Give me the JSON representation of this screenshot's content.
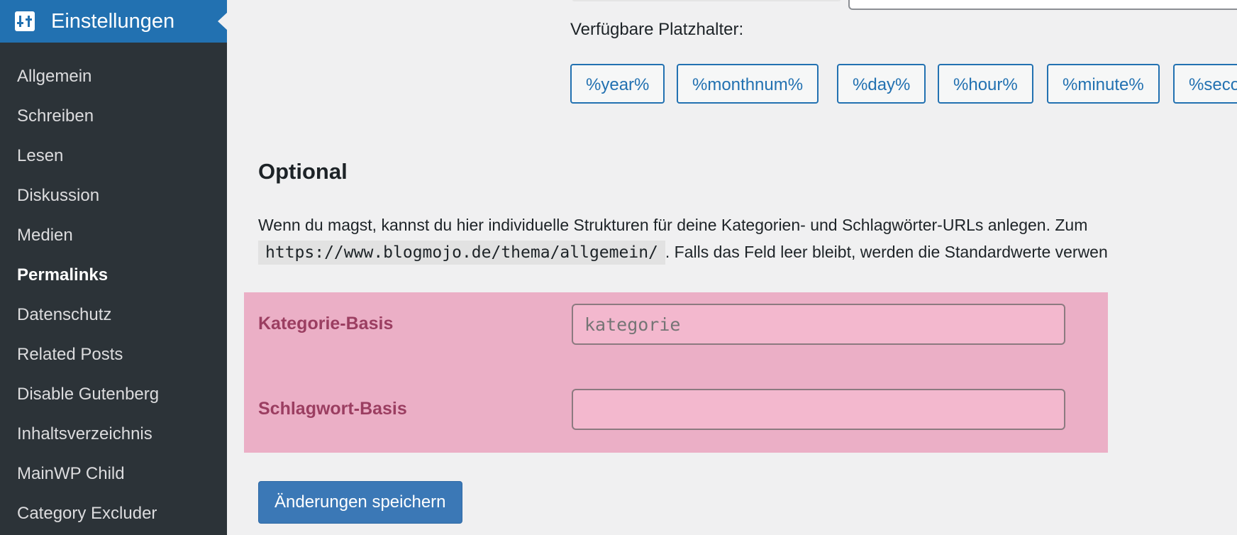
{
  "sidebar": {
    "section_title": "Einstellungen",
    "section_icon": "settings-icon",
    "items": [
      {
        "label": "Allgemein"
      },
      {
        "label": "Schreiben"
      },
      {
        "label": "Lesen"
      },
      {
        "label": "Diskussion"
      },
      {
        "label": "Medien"
      },
      {
        "label": "Permalinks"
      },
      {
        "label": "Datenschutz"
      },
      {
        "label": "Related Posts"
      },
      {
        "label": "Disable Gutenberg"
      },
      {
        "label": "Inhaltsverzeichnis"
      },
      {
        "label": "MainWP Child"
      },
      {
        "label": "Category Excluder"
      }
    ],
    "current_item": "Permalinks"
  },
  "placeholders": {
    "label": "Verfügbare Platzhalter:",
    "tags": [
      "%year%",
      "%monthnum%",
      "%day%",
      "%hour%",
      "%minute%",
      "%seco"
    ]
  },
  "optional": {
    "title": "Optional",
    "desc_line1": "Wenn du magst, kannst du hier individuelle Strukturen für deine Kategorien- und Schlagwörter-URLs anlegen. Zum",
    "desc_code": "https://www.blogmojo.de/thema/allgemein/",
    "desc_line2_rest": ". Falls das Feld leer bleibt, werden die Standardwerte verwen",
    "category_base_label": "Kategorie-Basis",
    "category_base_placeholder": "kategorie",
    "category_base_value": "",
    "tag_base_label": "Schlagwort-Basis",
    "tag_base_value": ""
  },
  "save_button": "Änderungen speichern",
  "colors": {
    "sidebar_bg": "#2c3338",
    "accent": "#2271b1",
    "highlight": "#ebafc6",
    "label_color": "#9b3e61"
  }
}
